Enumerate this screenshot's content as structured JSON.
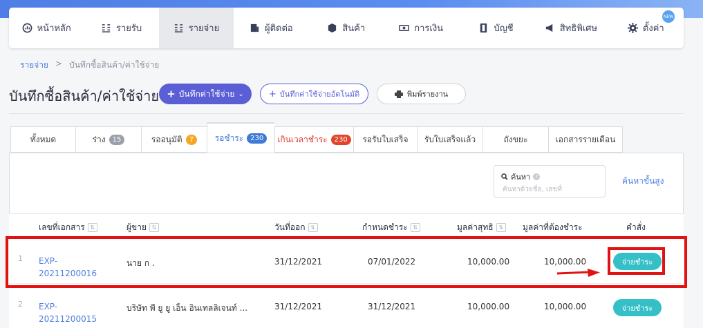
{
  "nav": {
    "items": [
      {
        "label": "หน้าหลัก",
        "icon": "dashboard-icon"
      },
      {
        "label": "รายรับ",
        "icon": "income-icon"
      },
      {
        "label": "รายจ่าย",
        "icon": "expense-icon"
      },
      {
        "label": "ผู้ติดต่อ",
        "icon": "contacts-icon"
      },
      {
        "label": "สินค้า",
        "icon": "box-icon"
      },
      {
        "label": "การเงิน",
        "icon": "money-icon"
      },
      {
        "label": "บัญชี",
        "icon": "book-icon"
      },
      {
        "label": "สิทธิพิเศษ",
        "icon": "megaphone-icon"
      },
      {
        "label": "ตั้งค่า",
        "icon": "gear-icon"
      }
    ],
    "new_badge": "NEW"
  },
  "breadcrumb": {
    "link": "รายจ่าย",
    "sep": ">",
    "current": "บันทึกซื้อสินค้า/ค่าใช้จ่าย"
  },
  "page": {
    "title": "บันทึกซื้อสินค้า/ค่าใช้จ่าย",
    "primary_button": "บันทึกค่าใช้จ่าย",
    "auto_button": "บันทึกค่าใช้จ่ายอัตโนมัติ",
    "print_button": "พิมพ์รายงาน"
  },
  "tabs": [
    {
      "label": "ทั้งหมด",
      "badge": ""
    },
    {
      "label": "ร่าง",
      "badge": "15",
      "badge_color": "#9aa0aa"
    },
    {
      "label": "รออนุมัติ",
      "badge": "7",
      "badge_color": "#f5a623"
    },
    {
      "label": "รอชำระ",
      "badge": "230",
      "badge_color": "#3f7ad6"
    },
    {
      "label": "เกินเวลาชำระ",
      "badge": "230",
      "badge_color": "#e0452c"
    },
    {
      "label": "รอรับใบเสร็จ",
      "badge": ""
    },
    {
      "label": "รับใบเสร็จแล้ว",
      "badge": ""
    },
    {
      "label": "ถังขยะ",
      "badge": ""
    },
    {
      "label": "เอกสารรายเดือน",
      "badge": ""
    }
  ],
  "search": {
    "label": "ค้นหา",
    "placeholder": "ค้นหาด้วยชื่อ, เลขที่",
    "advanced": "ค้นหาขั้นสูง"
  },
  "table": {
    "headers": {
      "doc_no": "เลขที่เอกสาร",
      "vendor": "ผู้ขาย",
      "issue_date": "วันที่ออก",
      "due_date": "กำหนดชำระ",
      "net": "มูลค่าสุทธิ",
      "payable": "มูลค่าที่ต้องชำระ",
      "action": "คำสั่ง"
    },
    "rows": [
      {
        "n": "1",
        "doc_line1": "EXP-",
        "doc_line2": "20211200016",
        "vendor": "นาย ก .",
        "issue_date": "31/12/2021",
        "due_date": "07/01/2022",
        "net": "10,000.00",
        "payable": "10,000.00",
        "action": "จ่ายชำระ"
      },
      {
        "n": "2",
        "doc_line1": "EXP-",
        "doc_line2": "20211200015",
        "vendor": "บริษัท พี ยู ยู เอ็น อินเทลลิเจนท์ ...",
        "issue_date": "31/12/2021",
        "due_date": "31/12/2021",
        "net": "10,000.00",
        "payable": "10,000.00",
        "action": "จ่ายชำระ"
      }
    ]
  }
}
